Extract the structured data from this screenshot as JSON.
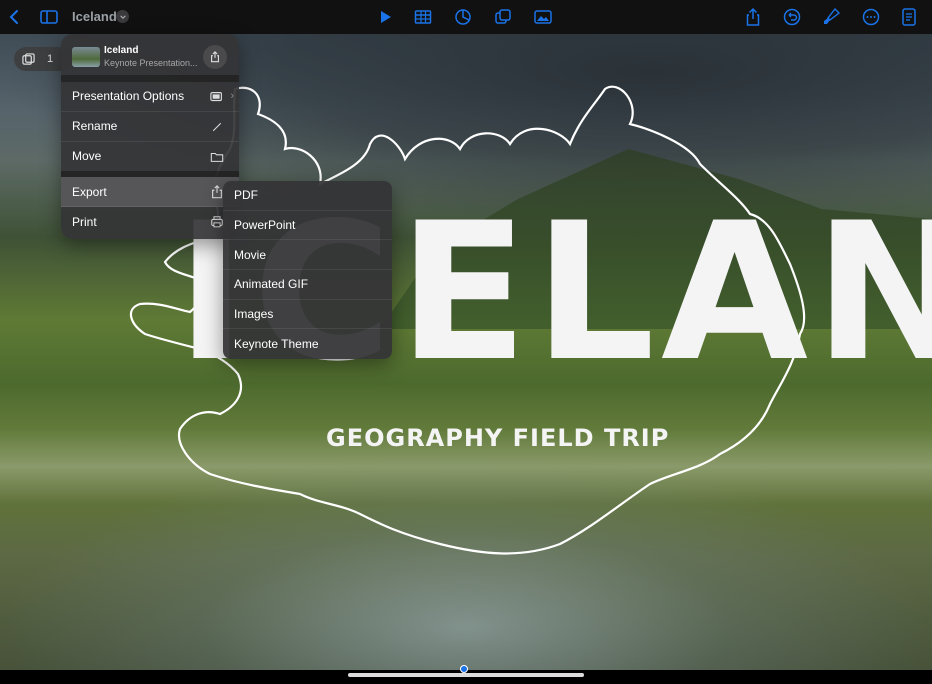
{
  "toolbar": {
    "back_icon": "chevron-left-icon",
    "sidebar_icon": "sidebar-icon",
    "title": "Iceland",
    "center_icons": [
      "play-icon",
      "table-icon",
      "chart-icon",
      "shapes-icon",
      "media-icon"
    ],
    "right_icons": [
      "share-icon",
      "undo-icon",
      "format-brush-icon",
      "more-icon",
      "document-setup-icon"
    ],
    "accent": "#1a73e8"
  },
  "slide_pill": {
    "count": "1"
  },
  "slide": {
    "title": "ICELAND",
    "subtitle": "GEOGRAPHY FIELD TRIP"
  },
  "menu": {
    "header": {
      "title": "Iceland",
      "subtitle": "Keynote Presentation..."
    },
    "items": [
      {
        "label": "Presentation Options",
        "icon": "presentation-icon"
      },
      {
        "label": "Rename",
        "icon": "pencil-icon"
      },
      {
        "label": "Move",
        "icon": "folder-icon"
      },
      {
        "label": "Export",
        "icon": "export-icon"
      },
      {
        "label": "Print",
        "icon": "printer-icon"
      }
    ]
  },
  "export_submenu": {
    "items": [
      "PDF",
      "PowerPoint",
      "Movie",
      "Animated GIF",
      "Images",
      "Keynote Theme"
    ]
  }
}
